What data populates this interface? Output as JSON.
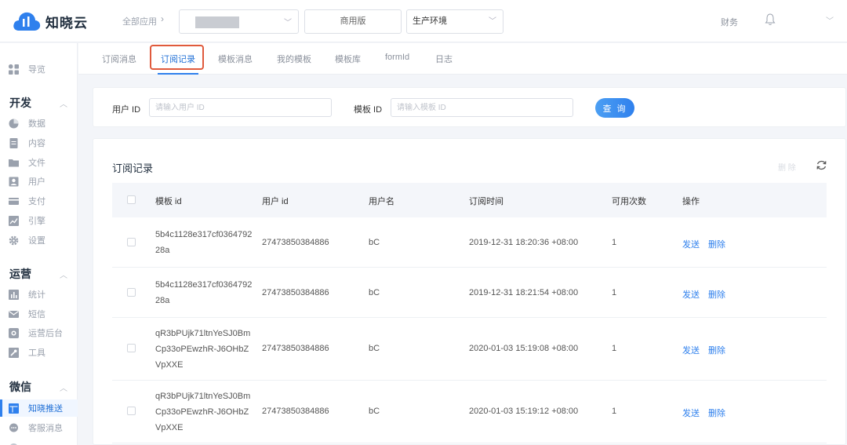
{
  "app": {
    "name": "知晓云"
  },
  "topbar": {
    "breadcrumb": "全部应用",
    "app_select_value": "",
    "edition": "商用版",
    "environment": "生产环境",
    "finance": "财务"
  },
  "sidebar": {
    "overview": "导览",
    "groups": [
      {
        "title": "开发",
        "items": [
          "数据",
          "内容",
          "文件",
          "用户",
          "支付",
          "引擎",
          "设置"
        ]
      },
      {
        "title": "运营",
        "items": [
          "统计",
          "短信",
          "运营后台",
          "工具"
        ]
      },
      {
        "title": "微信",
        "items": [
          "知晓推送",
          "客服消息"
        ]
      }
    ],
    "active_item": "知晓推送"
  },
  "tabs": [
    {
      "label": "订阅消息"
    },
    {
      "label": "订阅记录",
      "active": true
    },
    {
      "label": "模板消息"
    },
    {
      "label": "我的模板"
    },
    {
      "label": "模板库"
    },
    {
      "label": "formId"
    },
    {
      "label": "日志"
    }
  ],
  "search": {
    "user_id_label": "用户 ID",
    "user_id_placeholder": "请输入用户 ID",
    "template_id_label": "模板 ID",
    "template_id_placeholder": "请输入模板 ID",
    "query_button": "查 询"
  },
  "records": {
    "title": "订阅记录",
    "delete_button": "删 除",
    "columns": [
      "模板 id",
      "用户 id",
      "用户名",
      "订阅时间",
      "可用次数",
      "操作"
    ],
    "rows": [
      {
        "template_id": "5b4c1128e317cf036479228a",
        "user_id": "27473850384886",
        "username": "bC",
        "time": "2019-12-31 18:20:36 +08:00",
        "count": "1"
      },
      {
        "template_id": "5b4c1128e317cf036479228a",
        "user_id": "27473850384886",
        "username": "bC",
        "time": "2019-12-31 18:21:54 +08:00",
        "count": "1"
      },
      {
        "template_id": "qR3bPUjk71ltnYeSJ0BmCp33oPEwzhR-J6OHbZVpXXE",
        "user_id": "27473850384886",
        "username": "bC",
        "time": "2020-01-03 15:19:08 +08:00",
        "count": "1"
      },
      {
        "template_id": "qR3bPUjk71ltnYeSJ0BmCp33oPEwzhR-J6OHbZVpXXE",
        "user_id": "27473850384886",
        "username": "bC",
        "time": "2020-01-03 15:19:12 +08:00",
        "count": "1"
      }
    ],
    "action_send": "发送",
    "action_delete": "删除"
  },
  "icons": {
    "logo": "cloud-logo-icon",
    "bell": "bell-icon",
    "refresh": "refresh-icon"
  },
  "colors": {
    "accent": "#2f80ed",
    "highlight": "#e05a3c"
  }
}
